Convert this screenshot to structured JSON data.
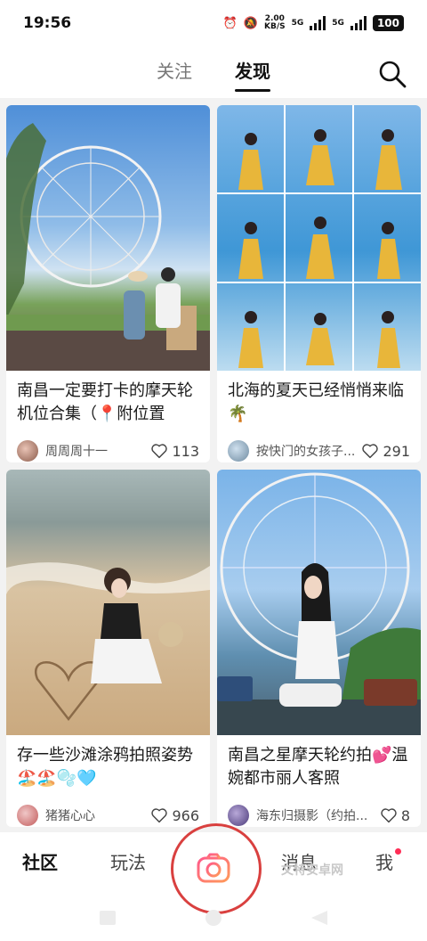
{
  "status": {
    "time": "19:56",
    "net_speed": "2.00",
    "net_unit": "KB/S",
    "sim1": "5G",
    "sim2": "5G",
    "battery": "100"
  },
  "topnav": {
    "tabs": [
      {
        "label": "关注"
      },
      {
        "label": "发现"
      }
    ]
  },
  "cards": [
    {
      "title": "南昌一定要打卡的摩天轮机位合集（📍附位置",
      "author": "周周周十一",
      "likes": "113"
    },
    {
      "title": "北海的夏天已经悄悄来临🌴",
      "author": "按快门的女孩子...",
      "likes": "291"
    },
    {
      "title": "存一些沙滩涂鸦拍照姿势🏖️🏖️🫧🩵",
      "author": "猪猪心心",
      "likes": "966"
    },
    {
      "title": "南昌之星摩天轮约拍💕温婉都市丽人客照",
      "author": "海东归摄影（约拍...",
      "likes": "8"
    }
  ],
  "bottomnav": {
    "home": "社区",
    "play": "玩法",
    "messages": "消息",
    "me": "我"
  },
  "watermark": "文特安卓网",
  "colors": {
    "accent_red": "#d9403f",
    "notification_dot": "#ff2d55"
  }
}
